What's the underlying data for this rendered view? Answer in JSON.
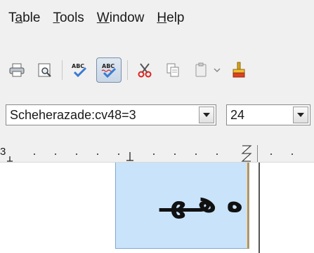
{
  "menubar": {
    "items": [
      {
        "pre": "T",
        "u": "a",
        "post": "ble"
      },
      {
        "pre": "",
        "u": "T",
        "post": "ools"
      },
      {
        "pre": "",
        "u": "W",
        "post": "indow"
      },
      {
        "pre": "",
        "u": "H",
        "post": "elp"
      }
    ]
  },
  "toolbar": {
    "icons": [
      "print-icon",
      "print-preview-icon",
      "spellcheck-icon",
      "autospellcheck-icon",
      "cut-icon",
      "copy-icon",
      "paste-icon",
      "paste-dropdown-icon",
      "clone-formatting-icon"
    ],
    "autospellcheck_active": true
  },
  "fontbar": {
    "font_name": "Scheherazade:cv48=3",
    "font_size": "24"
  },
  "ruler": {
    "start_number": "3"
  },
  "document": {
    "text": "ه هـهـ"
  },
  "colors": {
    "selection": "#c9e3fb",
    "cursor": "#d98b1a"
  }
}
